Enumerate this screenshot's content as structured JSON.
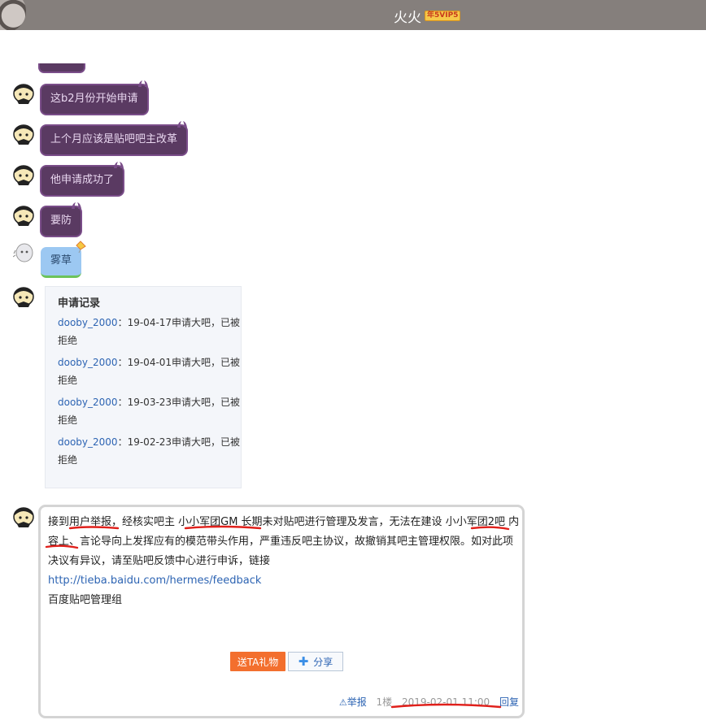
{
  "header": {
    "title": "火火",
    "badge": "年5VIP5"
  },
  "messages": [
    {
      "text": "这b2月份开始申请"
    },
    {
      "text": "上个月应该是贴吧吧主改革"
    },
    {
      "text": "他申请成功了"
    },
    {
      "text": "要防"
    },
    {
      "text": "雾草"
    }
  ],
  "record_card": {
    "title": "申请记录",
    "items": [
      {
        "user": "dooby_2000",
        "sep": "：",
        "text": "19-04-17申请大吧，已被拒绝"
      },
      {
        "user": "dooby_2000",
        "sep": "：",
        "text": "19-04-01申请大吧，已被拒绝"
      },
      {
        "user": "dooby_2000",
        "sep": "：",
        "text": "19-03-23申请大吧，已被拒绝"
      },
      {
        "user": "dooby_2000",
        "sep": "：",
        "text": "19-02-23申请大吧，已被拒绝"
      }
    ]
  },
  "post": {
    "body": "接到用户举报，经核实吧主 小小军团GM 长期未对贴吧进行管理及发言，无法在建设 小小军团2吧 内容上、言论导向上发挥应有的模范带头作用，严重违反吧主协议，故撤销其吧主管理权限。如对此项决议有异议，请至贴吧反馈中心进行申诉，链接",
    "link": "http://tieba.baidu.com/hermes/feedback",
    "signature": "百度贴吧管理组",
    "gift_label": "送TA礼物",
    "share_label": "分享",
    "report_label": "举报",
    "floor": "1楼",
    "time": "2019-02-01 11:00",
    "reply_label": "回复"
  },
  "colors": {
    "header_bg": "#857f7c",
    "bubble_bg": "#5a3a62",
    "link": "#2d64b3",
    "gift_button": "#f36f2e",
    "annotation_red": "#e0201b"
  }
}
